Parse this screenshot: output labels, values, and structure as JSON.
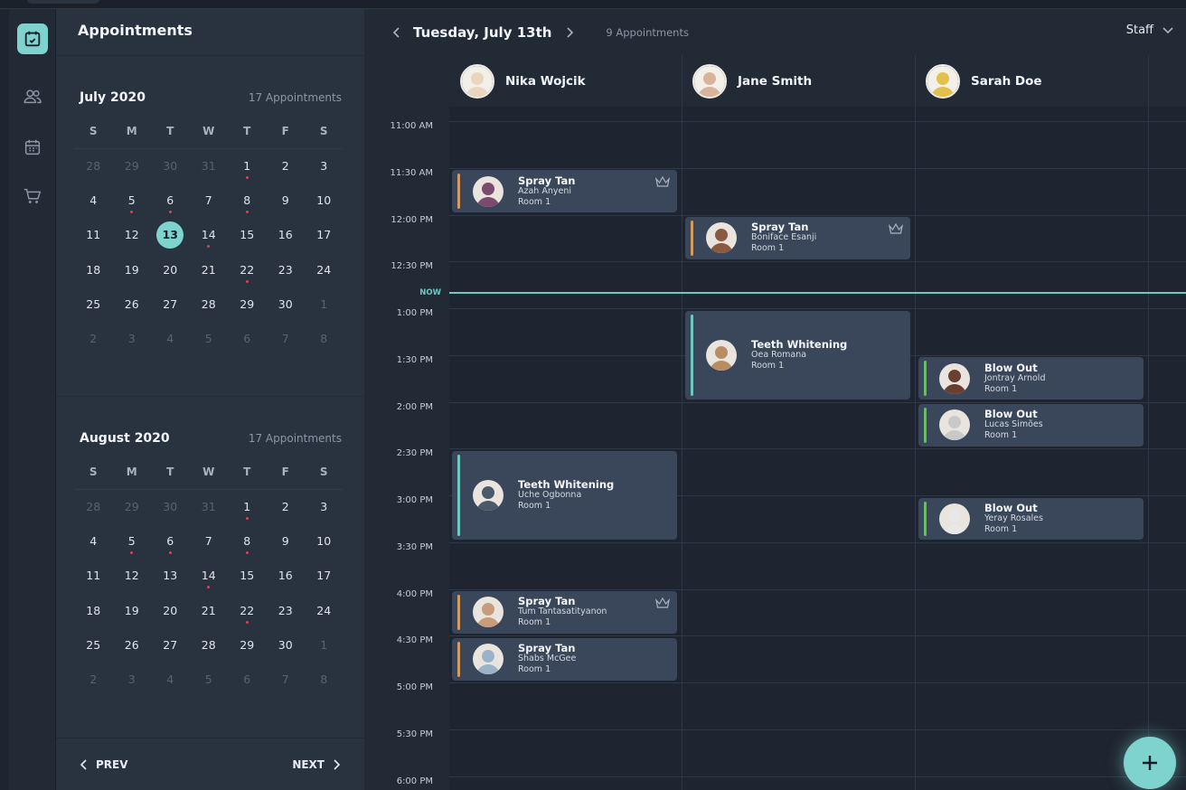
{
  "calendar_panel": {
    "title": "Appointments",
    "months": [
      {
        "title": "July 2020",
        "count": "17 Appointments",
        "weekdays": [
          "S",
          "M",
          "T",
          "W",
          "T",
          "F",
          "S"
        ],
        "days": [
          {
            "d": "28",
            "muted": true
          },
          {
            "d": "29",
            "muted": true
          },
          {
            "d": "30",
            "muted": true
          },
          {
            "d": "31",
            "muted": true
          },
          {
            "d": "1",
            "dot": true
          },
          {
            "d": "2"
          },
          {
            "d": "3"
          },
          {
            "d": "4"
          },
          {
            "d": "5",
            "dot": true
          },
          {
            "d": "6",
            "dot": true
          },
          {
            "d": "7"
          },
          {
            "d": "8",
            "dot": true
          },
          {
            "d": "9"
          },
          {
            "d": "10"
          },
          {
            "d": "11"
          },
          {
            "d": "12"
          },
          {
            "d": "13",
            "selected": true
          },
          {
            "d": "14",
            "dot": true
          },
          {
            "d": "15"
          },
          {
            "d": "16"
          },
          {
            "d": "17"
          },
          {
            "d": "18"
          },
          {
            "d": "19"
          },
          {
            "d": "20"
          },
          {
            "d": "21"
          },
          {
            "d": "22",
            "dot": true
          },
          {
            "d": "23"
          },
          {
            "d": "24"
          },
          {
            "d": "25"
          },
          {
            "d": "26"
          },
          {
            "d": "27"
          },
          {
            "d": "28"
          },
          {
            "d": "29"
          },
          {
            "d": "30"
          },
          {
            "d": "1",
            "muted": true
          },
          {
            "d": "2",
            "muted": true
          },
          {
            "d": "3",
            "muted": true
          },
          {
            "d": "4",
            "muted": true
          },
          {
            "d": "5",
            "muted": true
          },
          {
            "d": "6",
            "muted": true
          },
          {
            "d": "7",
            "muted": true
          },
          {
            "d": "8",
            "muted": true
          }
        ]
      },
      {
        "title": "August 2020",
        "count": "17 Appointments",
        "weekdays": [
          "S",
          "M",
          "T",
          "W",
          "T",
          "F",
          "S"
        ],
        "days": [
          {
            "d": "28",
            "muted": true
          },
          {
            "d": "29",
            "muted": true
          },
          {
            "d": "30",
            "muted": true
          },
          {
            "d": "31",
            "muted": true
          },
          {
            "d": "1",
            "dot": true
          },
          {
            "d": "2"
          },
          {
            "d": "3"
          },
          {
            "d": "4"
          },
          {
            "d": "5",
            "dot": true
          },
          {
            "d": "6",
            "dot": true
          },
          {
            "d": "7"
          },
          {
            "d": "8",
            "dot": true
          },
          {
            "d": "9"
          },
          {
            "d": "10"
          },
          {
            "d": "11"
          },
          {
            "d": "12"
          },
          {
            "d": "13"
          },
          {
            "d": "14",
            "dot": true
          },
          {
            "d": "15"
          },
          {
            "d": "16"
          },
          {
            "d": "17"
          },
          {
            "d": "18"
          },
          {
            "d": "19"
          },
          {
            "d": "20"
          },
          {
            "d": "21"
          },
          {
            "d": "22",
            "dot": true
          },
          {
            "d": "23"
          },
          {
            "d": "24"
          },
          {
            "d": "25"
          },
          {
            "d": "26"
          },
          {
            "d": "27"
          },
          {
            "d": "28"
          },
          {
            "d": "29"
          },
          {
            "d": "30"
          },
          {
            "d": "1",
            "muted": true
          },
          {
            "d": "2",
            "muted": true
          },
          {
            "d": "3",
            "muted": true
          },
          {
            "d": "4",
            "muted": true
          },
          {
            "d": "5",
            "muted": true
          },
          {
            "d": "6",
            "muted": true
          },
          {
            "d": "7",
            "muted": true
          },
          {
            "d": "8",
            "muted": true
          }
        ]
      }
    ],
    "prev_label": "PREV",
    "next_label": "NEXT"
  },
  "schedule": {
    "date": "Tuesday, July 13th",
    "count": "9 Appointments",
    "filter": "Staff",
    "now_label": "NOW",
    "staff": [
      {
        "name": "Nika Wojcik",
        "avatar_color": "#e9d6bf"
      },
      {
        "name": "Jane Smith",
        "avatar_color": "#d9b49a"
      },
      {
        "name": "Sarah Doe",
        "avatar_color": "#e3c04a"
      }
    ],
    "times": [
      "11:00 AM",
      "11:30 AM",
      "12:00 PM",
      "12:30 PM",
      "1:00 PM",
      "1:30 PM",
      "2:00 PM",
      "2:30 PM",
      "3:00 PM",
      "3:30 PM",
      "4:00 PM",
      "4:30 PM",
      "5:00 PM",
      "5:30 PM",
      "6:00 PM"
    ],
    "appointments": [
      {
        "staff": 0,
        "start": "11:30 AM",
        "end": "12:00 PM",
        "service": "Spray Tan",
        "client": "Azah Anyeni",
        "room": "Room 1",
        "accent": "#d59a5f",
        "crown": true,
        "photo": "#7b4a6e"
      },
      {
        "staff": 1,
        "start": "12:00 PM",
        "end": "12:30 PM",
        "service": "Spray Tan",
        "client": "Boniface Esanji",
        "room": "Room 1",
        "accent": "#d59a5f",
        "crown": true,
        "photo": "#8a5a40"
      },
      {
        "staff": 1,
        "start": "1:00 PM",
        "end": "2:00 PM",
        "service": "Teeth Whitening",
        "client": "Oea Romana",
        "room": "Room 1",
        "accent": "#6fc7c2",
        "crown": false,
        "photo": "#b98d63"
      },
      {
        "staff": 2,
        "start": "1:30 PM",
        "end": "2:00 PM",
        "service": "Blow Out",
        "client": "Jontray Arnold",
        "room": "Room 1",
        "accent": "#6db86a",
        "crown": false,
        "photo": "#6a3f32"
      },
      {
        "staff": 2,
        "start": "2:00 PM",
        "end": "2:30 PM",
        "service": "Blow Out",
        "client": "Lucas Simões",
        "room": "Room 1",
        "accent": "#6db86a",
        "crown": false,
        "photo": "#c9c9c9"
      },
      {
        "staff": 0,
        "start": "2:30 PM",
        "end": "3:30 PM",
        "service": "Teeth Whitening",
        "client": "Uche Ogbonna",
        "room": "Room 1",
        "accent": "#6fc7c2",
        "crown": false,
        "photo": "#4b5a6a"
      },
      {
        "staff": 2,
        "start": "3:00 PM",
        "end": "3:30 PM",
        "service": "Blow Out",
        "client": "Yeray Rosales",
        "room": "Room 1",
        "accent": "#6db86a",
        "crown": false,
        "photo": "#e8e8e8"
      },
      {
        "staff": 0,
        "start": "4:00 PM",
        "end": "4:30 PM",
        "service": "Spray Tan",
        "client": "Tum Tantasatityanon",
        "room": "Room 1",
        "accent": "#d59a5f",
        "crown": true,
        "photo": "#c89b7b"
      },
      {
        "staff": 0,
        "start": "4:30 PM",
        "end": "5:00 PM",
        "service": "Spray Tan",
        "client": "Shabs McGee",
        "room": "Room 1",
        "accent": "#d59a5f",
        "crown": false,
        "photo": "#9bb3c9"
      }
    ]
  },
  "colors": {
    "accent": "#7fd3cf",
    "event_dot": "#e0424a",
    "panel": "#29323f"
  }
}
